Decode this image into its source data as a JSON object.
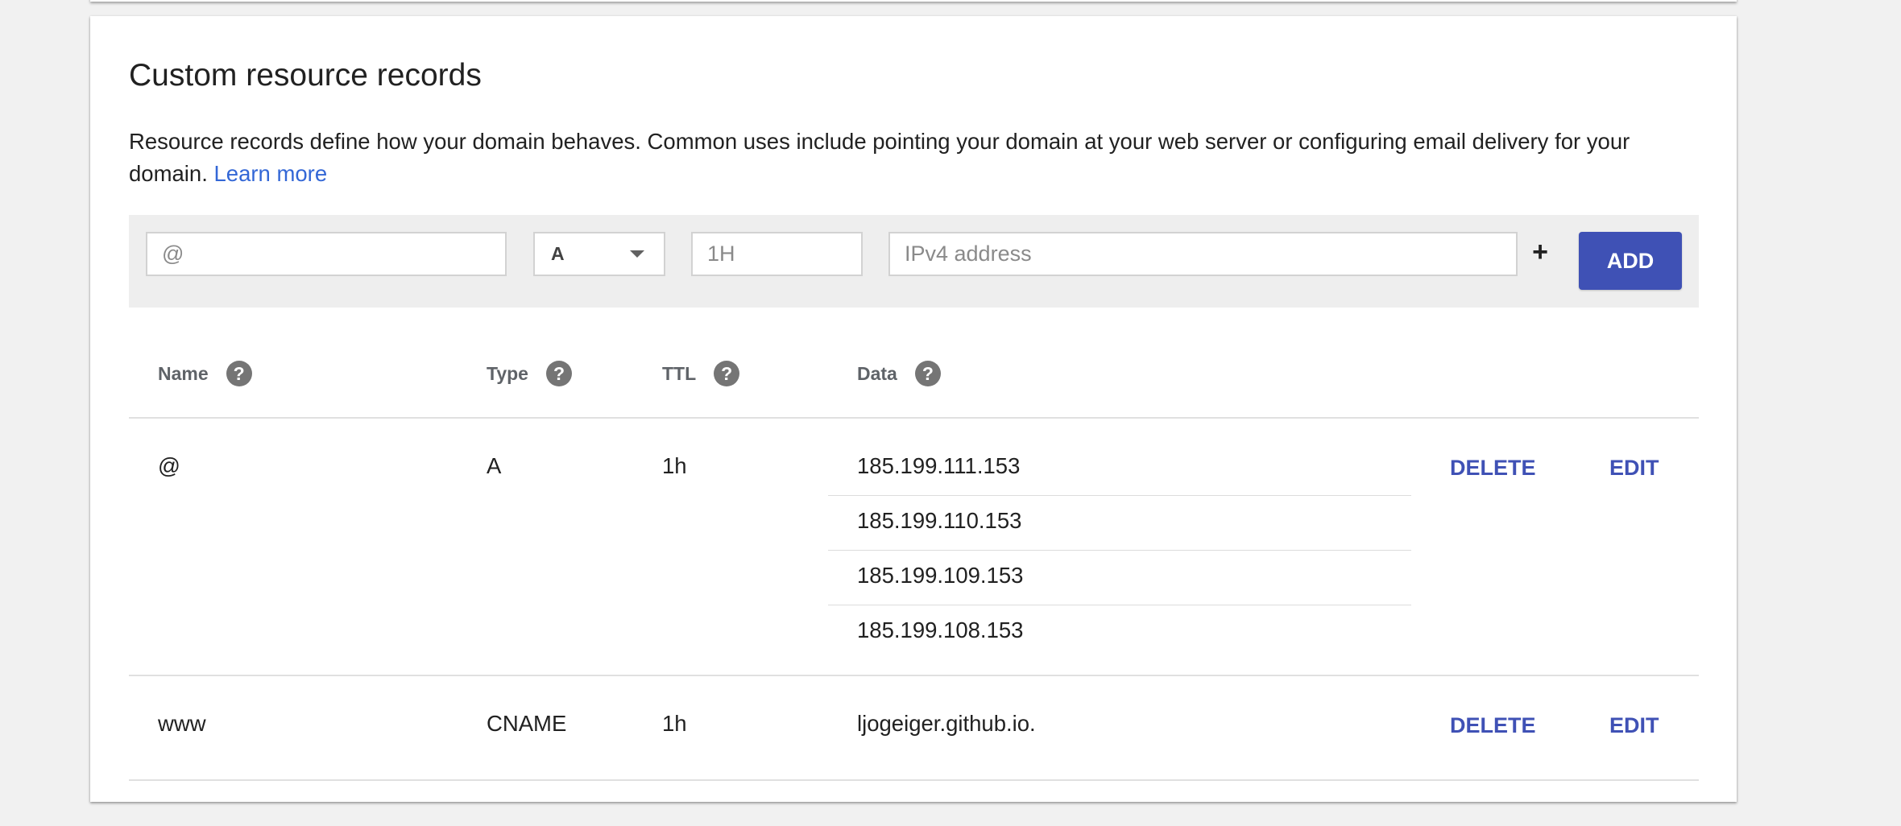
{
  "section": {
    "title": "Custom resource records",
    "description": "Resource records define how your domain behaves. Common uses include pointing your domain at your web server or configuring email delivery for your domain.",
    "learn_more": "Learn more"
  },
  "add_form": {
    "name_placeholder": "@",
    "type_value": "A",
    "ttl_placeholder": "1H",
    "data_placeholder": "IPv4 address",
    "plus": "+",
    "add_label": "ADD"
  },
  "table": {
    "columns": [
      {
        "label": "Name",
        "help": "?"
      },
      {
        "label": "Type",
        "help": "?"
      },
      {
        "label": "TTL",
        "help": "?"
      },
      {
        "label": "Data",
        "help": "?"
      }
    ],
    "rows": [
      {
        "name": "@",
        "type": "A",
        "ttl": "1h",
        "data": [
          "185.199.111.153",
          "185.199.110.153",
          "185.199.109.153",
          "185.199.108.153"
        ],
        "delete_label": "DELETE",
        "edit_label": "EDIT"
      },
      {
        "name": "www",
        "type": "CNAME",
        "ttl": "1h",
        "data": [
          "ljogeiger.github.io."
        ],
        "delete_label": "DELETE",
        "edit_label": "EDIT"
      }
    ]
  },
  "colors": {
    "accent": "#3f51b5",
    "link": "#3367d6",
    "background": "#f1f1f1"
  },
  "icons": {
    "help": "help-circle-icon",
    "dropdown": "chevron-down-icon",
    "add": "plus-icon"
  }
}
